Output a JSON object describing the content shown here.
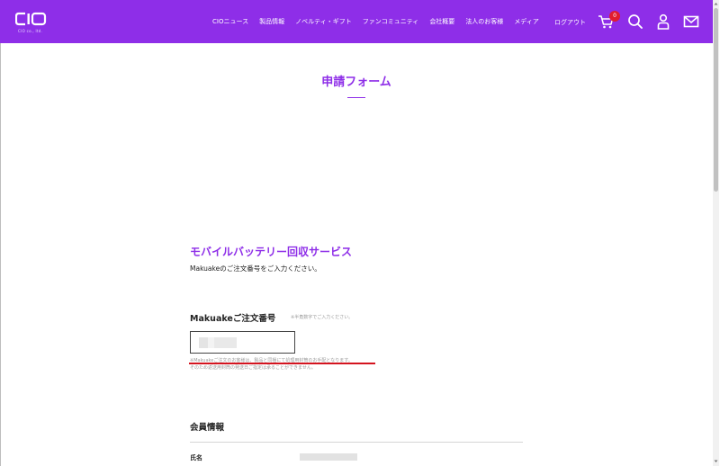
{
  "header": {
    "logo_text": "CIO",
    "logo_sub": "CIO co., ltd.",
    "nav": [
      "CIOニュース",
      "製品情報",
      "ノベルティ・ギフト",
      "ファンコミュニティ",
      "会社概要",
      "法人のお客様",
      "メディア"
    ],
    "logout": "ログアウト",
    "cart_count": "0",
    "icons": [
      "cart-icon",
      "search-icon",
      "user-icon",
      "mail-icon"
    ]
  },
  "page": {
    "title": "申請フォーム"
  },
  "section": {
    "title": "モバイルバッテリー回収サービス",
    "description": "Makuakeのご注文番号をご入力ください。"
  },
  "order_field": {
    "label": "Makuakeご注文番号",
    "hint": "※半角数字でご入力ください。",
    "note1": "※Makuakeご注文のお客様は、製品と同梱にて処理用封筒のお手配となります。",
    "note2": "そのため返送用封筒の発送日ご指定は承ることができません。"
  },
  "member": {
    "title": "会員情報",
    "name_label": "氏名"
  },
  "colors": {
    "brand": "#8e2ee8",
    "accent_red": "#d4141f",
    "badge": "#e11d2f"
  }
}
